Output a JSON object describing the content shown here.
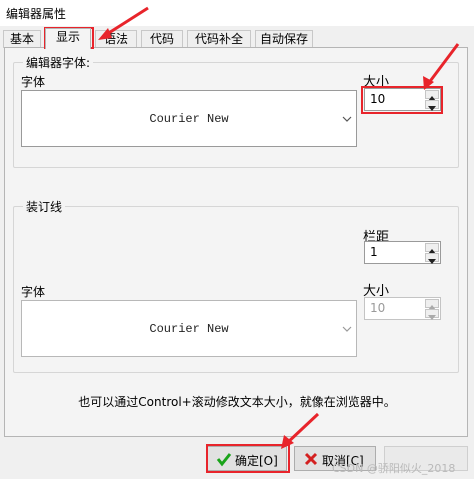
{
  "window": {
    "title": "编辑器属性"
  },
  "tabs": [
    {
      "label": "基本"
    },
    {
      "label": "显示"
    },
    {
      "label": "语法"
    },
    {
      "label": "代码"
    },
    {
      "label": "代码补全"
    },
    {
      "label": "自动保存"
    }
  ],
  "active_tab": "显示",
  "editor_font": {
    "group_title": "编辑器字体:",
    "font_label": "字体",
    "font_value": "Courier New",
    "size_label": "大小",
    "size_value": "10"
  },
  "gutter": {
    "group_title": "装订线",
    "margin_label": "栏距",
    "margin_value": "1",
    "font_label": "字体",
    "font_value": "Courier New",
    "size_label": "大小",
    "size_value": "10"
  },
  "hint": "也可以通过Control+滚动修改文本大小，就像在浏览器中。",
  "buttons": {
    "ok": "确定[O]",
    "cancel": "取消[C]"
  },
  "watermark": "CSDN @骄阳似火_2018",
  "colors": {
    "highlight": "#e8242b",
    "ok_check": "#1aa31a",
    "cancel_x": "#d32020"
  }
}
